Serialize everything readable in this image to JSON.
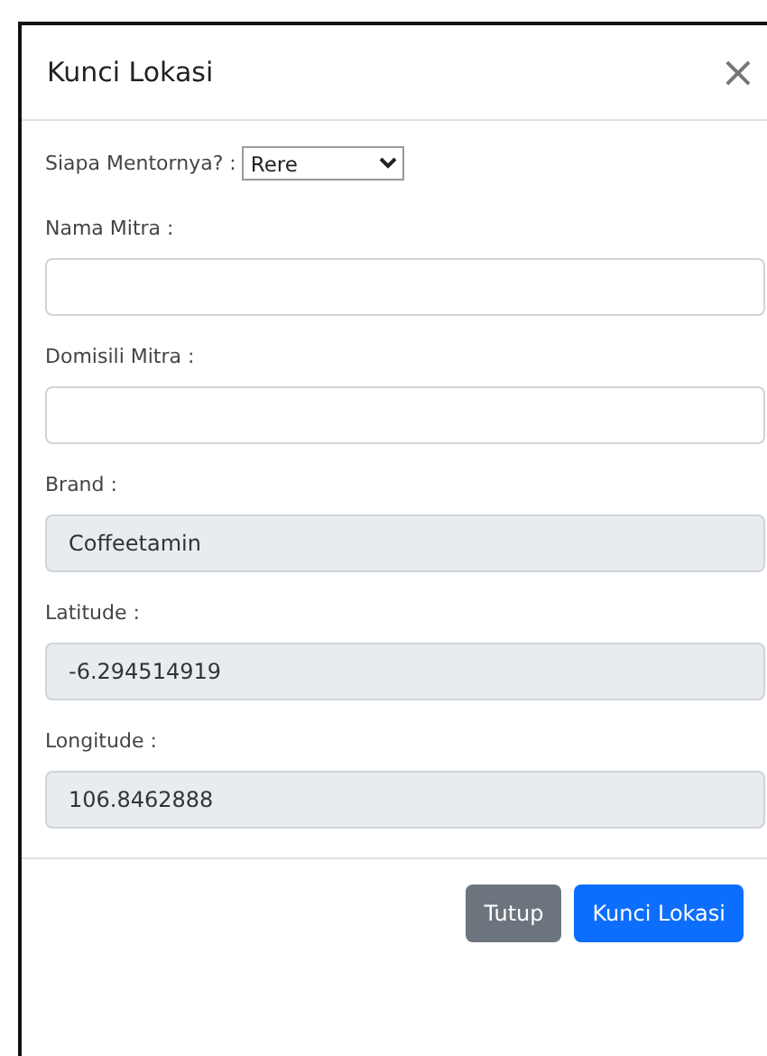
{
  "modal": {
    "title": "Kunci Lokasi",
    "close": "×"
  },
  "mentor": {
    "label": "Siapa Mentornya? :",
    "value": "Rere"
  },
  "fields": [
    {
      "label": "Nama Mitra :",
      "disabled": false
    },
    {
      "label": "Domisili Mitra :",
      "disabled": false
    },
    {
      "label": "Brand :",
      "value": "Coffeetamin",
      "disabled": true
    },
    {
      "label": "Latitude :",
      "value": "-6.294514919",
      "disabled": true
    },
    {
      "label": "Longitude :",
      "value": "106.8462888",
      "disabled": true
    }
  ],
  "buttons": [
    {
      "label": "Tutup",
      "kind": "secondary"
    },
    {
      "label": "Kunci Lokasi",
      "kind": "primary"
    }
  ]
}
